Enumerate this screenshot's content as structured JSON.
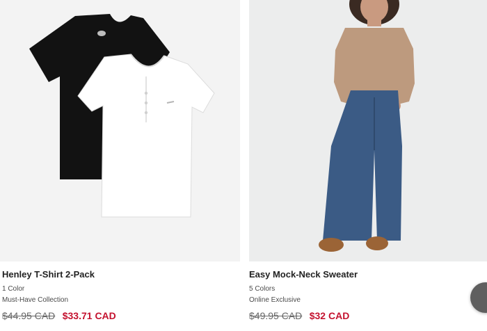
{
  "products": [
    {
      "name": "Henley T-Shirt 2-Pack",
      "colors": "1 Color",
      "tag": "Must-Have Collection",
      "old_price": "$44.95 CAD",
      "sale_price": "$33.71 CAD",
      "image_icon": "tshirt-2pack-image"
    },
    {
      "name": "Easy Mock-Neck Sweater",
      "colors": "5 Colors",
      "tag": "Online Exclusive",
      "old_price": "$49.95 CAD",
      "sale_price": "$32 CAD",
      "image_icon": "model-sweater-jeans-image"
    }
  ],
  "colors": {
    "sale": "#c4122f",
    "text": "#222222",
    "muted": "#666666"
  }
}
